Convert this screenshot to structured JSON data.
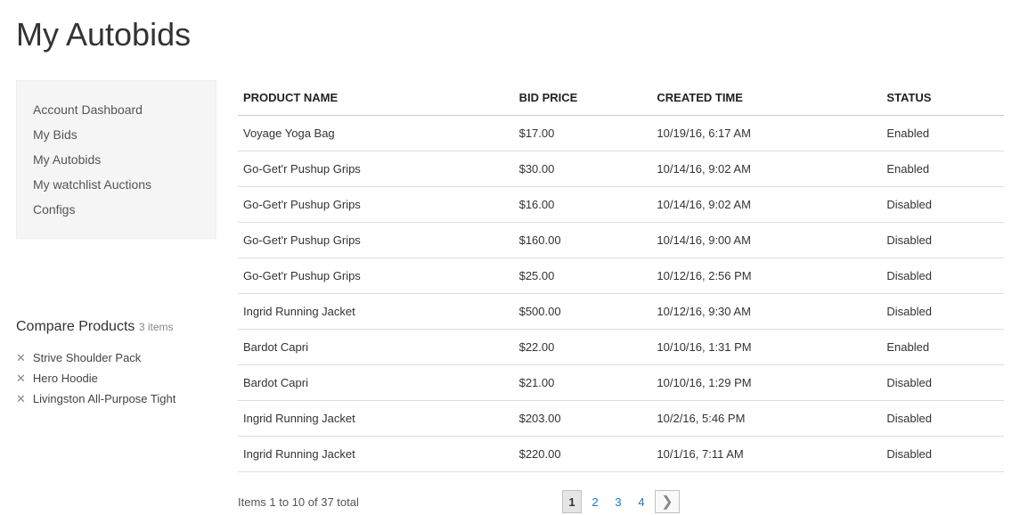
{
  "page": {
    "title": "My Autobids"
  },
  "sidebar": {
    "items": [
      {
        "label": "Account Dashboard"
      },
      {
        "label": "My Bids"
      },
      {
        "label": "My Autobids"
      },
      {
        "label": "My watchlist Auctions"
      },
      {
        "label": "Configs"
      }
    ]
  },
  "compare": {
    "title": "Compare Products",
    "count_label": "3 items",
    "items": [
      {
        "label": "Strive Shoulder Pack"
      },
      {
        "label": "Hero Hoodie"
      },
      {
        "label": "Livingston All-Purpose Tight"
      }
    ]
  },
  "table": {
    "headers": {
      "name": "PRODUCT NAME",
      "price": "BID PRICE",
      "time": "CREATED TIME",
      "status": "STATUS"
    },
    "rows": [
      {
        "name": "Voyage Yoga Bag",
        "price": "$17.00",
        "time": "10/19/16, 6:17 AM",
        "status": "Enabled"
      },
      {
        "name": "Go-Get'r Pushup Grips",
        "price": "$30.00",
        "time": "10/14/16, 9:02 AM",
        "status": "Enabled"
      },
      {
        "name": "Go-Get'r Pushup Grips",
        "price": "$16.00",
        "time": "10/14/16, 9:02 AM",
        "status": "Disabled"
      },
      {
        "name": "Go-Get'r Pushup Grips",
        "price": "$160.00",
        "time": "10/14/16, 9:00 AM",
        "status": "Disabled"
      },
      {
        "name": "Go-Get'r Pushup Grips",
        "price": "$25.00",
        "time": "10/12/16, 2:56 PM",
        "status": "Disabled"
      },
      {
        "name": "Ingrid Running Jacket",
        "price": "$500.00",
        "time": "10/12/16, 9:30 AM",
        "status": "Disabled"
      },
      {
        "name": "Bardot Capri",
        "price": "$22.00",
        "time": "10/10/16, 1:31 PM",
        "status": "Enabled"
      },
      {
        "name": "Bardot Capri",
        "price": "$21.00",
        "time": "10/10/16, 1:29 PM",
        "status": "Disabled"
      },
      {
        "name": "Ingrid Running Jacket",
        "price": "$203.00",
        "time": "10/2/16, 5:46 PM",
        "status": "Disabled"
      },
      {
        "name": "Ingrid Running Jacket",
        "price": "$220.00",
        "time": "10/1/16, 7:11 AM",
        "status": "Disabled"
      }
    ]
  },
  "toolbar": {
    "count": "Items 1 to 10 of 37 total",
    "pages": [
      "1",
      "2",
      "3",
      "4"
    ],
    "current_page": "1",
    "next_glyph": "❯"
  }
}
